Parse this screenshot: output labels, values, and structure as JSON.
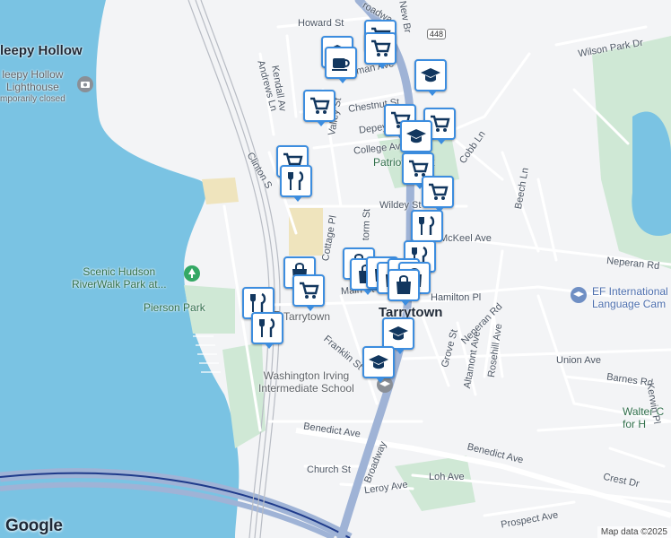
{
  "map": {
    "attribution": "Map data ©2025",
    "logo": "Google",
    "route_shield": "448"
  },
  "places": {
    "towns": [
      {
        "name": "leepy Hollow",
        "key": "sleepy-hollow-partial"
      },
      {
        "name": "Tarrytown",
        "key": "tarrytown"
      }
    ],
    "pois": [
      {
        "key": "lighthouse",
        "lines": [
          "leepy Hollow",
          "Lighthouse",
          "mporarily closed"
        ],
        "icon": "camera-icon"
      },
      {
        "key": "riverwalk",
        "lines": [
          "Scenic Hudson",
          "RiverWalk Park at..."
        ],
        "icon": "tree-icon"
      },
      {
        "key": "pierson-park",
        "lines": [
          "Pierson Park"
        ]
      },
      {
        "key": "patriots-park",
        "lines": [
          "Patriots Park"
        ]
      },
      {
        "key": "washington-irving",
        "lines": [
          "Washington Irving",
          "Intermediate School"
        ],
        "icon": "school-icon"
      },
      {
        "key": "ef-international",
        "lines": [
          "EF International",
          "Language Cam"
        ],
        "icon": "school-icon"
      },
      {
        "key": "walter",
        "lines": [
          "Walter C",
          "for H"
        ]
      },
      {
        "key": "tarrytown-station",
        "lines": [
          "Tarrytown"
        ],
        "icon": "train-icon"
      }
    ],
    "streets": [
      {
        "key": "howard-st",
        "name": "Howard St"
      },
      {
        "key": "kendall-ave",
        "name": "Kendall Av"
      },
      {
        "key": "andrews-ln",
        "name": "Andrews Ln"
      },
      {
        "key": "beekman-ave",
        "name": "Beekman Ave"
      },
      {
        "key": "chestnut-st",
        "name": "Chestnut St"
      },
      {
        "key": "depeyster-st",
        "name": "Depeyst"
      },
      {
        "key": "college-ave",
        "name": "College Av"
      },
      {
        "key": "valley-st",
        "name": "Valley St"
      },
      {
        "key": "clinton-st",
        "name": "Clinton S"
      },
      {
        "key": "cobb-ln",
        "name": "Cobb Ln"
      },
      {
        "key": "beech-ln",
        "name": "Beech Ln"
      },
      {
        "key": "wildey-st",
        "name": "Wildey St"
      },
      {
        "key": "mckeel-ave",
        "name": "McKeel Ave"
      },
      {
        "key": "neperan-rd-east",
        "name": "Neperan Rd"
      },
      {
        "key": "cottage-pl",
        "name": "Cottage Pl"
      },
      {
        "key": "storm-st",
        "name": "torm St"
      },
      {
        "key": "main-st",
        "name": "Main St"
      },
      {
        "key": "hamilton-pl",
        "name": "Hamilton Pl"
      },
      {
        "key": "neperan-rd",
        "name": "Neperan Rd"
      },
      {
        "key": "franklin-st",
        "name": "Franklin St"
      },
      {
        "key": "grove-st",
        "name": "Grove St"
      },
      {
        "key": "altamont-ave",
        "name": "Altamont Ave"
      },
      {
        "key": "rosehill-ave",
        "name": "Rosehill Ave"
      },
      {
        "key": "union-ave",
        "name": "Union Ave"
      },
      {
        "key": "barnes-rd",
        "name": "Barnes Rd"
      },
      {
        "key": "kerwin-pl",
        "name": "Kerwin Pl"
      },
      {
        "key": "broadway",
        "name": "Broadway"
      },
      {
        "key": "broadway-north",
        "name": "roadwa"
      },
      {
        "key": "new-broadway",
        "name": "New Br"
      },
      {
        "key": "benedict-ave",
        "name": "Benedict Ave"
      },
      {
        "key": "benedict-ave-east",
        "name": "Benedict Ave"
      },
      {
        "key": "church-st",
        "name": "Church St"
      },
      {
        "key": "leroy-ave",
        "name": "Leroy Ave"
      },
      {
        "key": "loh-ave",
        "name": "Loh Ave"
      },
      {
        "key": "crest-dr",
        "name": "Crest Dr"
      },
      {
        "key": "prospect-ave",
        "name": "Prospect Ave"
      },
      {
        "key": "wilson-park-dr",
        "name": "Wilson Park Dr"
      }
    ]
  },
  "markers": [
    {
      "type": "grocery",
      "icon": "shopping-cart-icon"
    },
    {
      "type": "grocery",
      "icon": "shopping-cart-icon"
    },
    {
      "type": "school",
      "icon": "graduation-cap-icon"
    },
    {
      "type": "cafe",
      "icon": "coffee-cup-icon"
    },
    {
      "type": "grocery",
      "icon": "shopping-cart-icon"
    },
    {
      "type": "school",
      "icon": "graduation-cap-icon"
    },
    {
      "type": "grocery",
      "icon": "shopping-cart-icon"
    },
    {
      "type": "grocery",
      "icon": "shopping-cart-icon"
    },
    {
      "type": "school",
      "icon": "graduation-cap-icon"
    },
    {
      "type": "grocery",
      "icon": "shopping-cart-icon"
    },
    {
      "type": "grocery",
      "icon": "shopping-cart-icon"
    },
    {
      "type": "grocery",
      "icon": "shopping-cart-icon"
    },
    {
      "type": "restaurant",
      "icon": "fork-knife-icon"
    },
    {
      "type": "restaurant",
      "icon": "fork-knife-icon"
    },
    {
      "type": "restaurant",
      "icon": "fork-knife-icon"
    },
    {
      "type": "shopping",
      "icon": "shopping-bag-icon"
    },
    {
      "type": "shopping",
      "icon": "shopping-bag-icon"
    },
    {
      "type": "shopping",
      "icon": "shopping-bag-icon"
    },
    {
      "type": "shopping",
      "icon": "shopping-bag-icon"
    },
    {
      "type": "shopping",
      "icon": "shopping-bag-icon"
    },
    {
      "type": "shopping",
      "icon": "shopping-bag-icon"
    },
    {
      "type": "shopping",
      "icon": "shopping-bag-icon"
    },
    {
      "type": "shopping",
      "icon": "shopping-bag-icon"
    },
    {
      "type": "restaurant",
      "icon": "fork-knife-icon"
    },
    {
      "type": "restaurant",
      "icon": "fork-knife-icon"
    },
    {
      "type": "grocery",
      "icon": "shopping-cart-icon"
    },
    {
      "type": "school",
      "icon": "graduation-cap-icon"
    },
    {
      "type": "school",
      "icon": "graduation-cap-icon"
    }
  ],
  "colors": {
    "water": "#7ac3e3",
    "land": "#f3f4f6",
    "park": "#cfe8d5",
    "road": "#ffffff",
    "highway": "#9fb3d6",
    "marker_border": "#3c8ddf",
    "marker_icon": "#12375f"
  }
}
